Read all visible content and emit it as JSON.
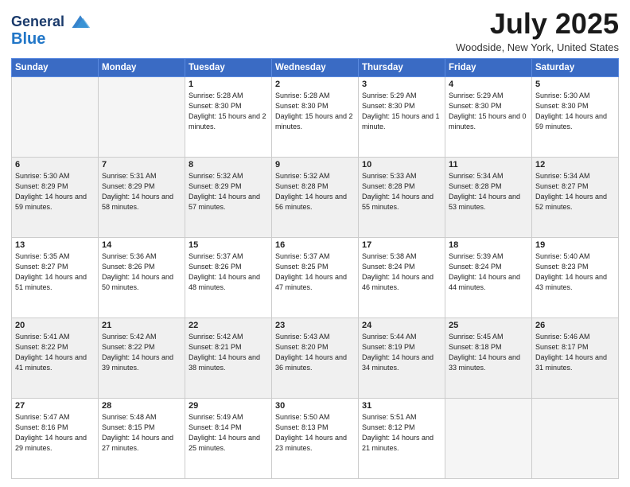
{
  "header": {
    "logo_line1": "General",
    "logo_line2": "Blue",
    "month_title": "July 2025",
    "location": "Woodside, New York, United States"
  },
  "weekdays": [
    "Sunday",
    "Monday",
    "Tuesday",
    "Wednesday",
    "Thursday",
    "Friday",
    "Saturday"
  ],
  "weeks": [
    [
      {
        "day": null
      },
      {
        "day": null
      },
      {
        "day": "1",
        "rise": "Sunrise: 5:28 AM",
        "set": "Sunset: 8:30 PM",
        "daylight": "Daylight: 15 hours and 2 minutes."
      },
      {
        "day": "2",
        "rise": "Sunrise: 5:28 AM",
        "set": "Sunset: 8:30 PM",
        "daylight": "Daylight: 15 hours and 2 minutes."
      },
      {
        "day": "3",
        "rise": "Sunrise: 5:29 AM",
        "set": "Sunset: 8:30 PM",
        "daylight": "Daylight: 15 hours and 1 minute."
      },
      {
        "day": "4",
        "rise": "Sunrise: 5:29 AM",
        "set": "Sunset: 8:30 PM",
        "daylight": "Daylight: 15 hours and 0 minutes."
      },
      {
        "day": "5",
        "rise": "Sunrise: 5:30 AM",
        "set": "Sunset: 8:30 PM",
        "daylight": "Daylight: 14 hours and 59 minutes."
      }
    ],
    [
      {
        "day": "6",
        "rise": "Sunrise: 5:30 AM",
        "set": "Sunset: 8:29 PM",
        "daylight": "Daylight: 14 hours and 59 minutes."
      },
      {
        "day": "7",
        "rise": "Sunrise: 5:31 AM",
        "set": "Sunset: 8:29 PM",
        "daylight": "Daylight: 14 hours and 58 minutes."
      },
      {
        "day": "8",
        "rise": "Sunrise: 5:32 AM",
        "set": "Sunset: 8:29 PM",
        "daylight": "Daylight: 14 hours and 57 minutes."
      },
      {
        "day": "9",
        "rise": "Sunrise: 5:32 AM",
        "set": "Sunset: 8:28 PM",
        "daylight": "Daylight: 14 hours and 56 minutes."
      },
      {
        "day": "10",
        "rise": "Sunrise: 5:33 AM",
        "set": "Sunset: 8:28 PM",
        "daylight": "Daylight: 14 hours and 55 minutes."
      },
      {
        "day": "11",
        "rise": "Sunrise: 5:34 AM",
        "set": "Sunset: 8:28 PM",
        "daylight": "Daylight: 14 hours and 53 minutes."
      },
      {
        "day": "12",
        "rise": "Sunrise: 5:34 AM",
        "set": "Sunset: 8:27 PM",
        "daylight": "Daylight: 14 hours and 52 minutes."
      }
    ],
    [
      {
        "day": "13",
        "rise": "Sunrise: 5:35 AM",
        "set": "Sunset: 8:27 PM",
        "daylight": "Daylight: 14 hours and 51 minutes."
      },
      {
        "day": "14",
        "rise": "Sunrise: 5:36 AM",
        "set": "Sunset: 8:26 PM",
        "daylight": "Daylight: 14 hours and 50 minutes."
      },
      {
        "day": "15",
        "rise": "Sunrise: 5:37 AM",
        "set": "Sunset: 8:26 PM",
        "daylight": "Daylight: 14 hours and 48 minutes."
      },
      {
        "day": "16",
        "rise": "Sunrise: 5:37 AM",
        "set": "Sunset: 8:25 PM",
        "daylight": "Daylight: 14 hours and 47 minutes."
      },
      {
        "day": "17",
        "rise": "Sunrise: 5:38 AM",
        "set": "Sunset: 8:24 PM",
        "daylight": "Daylight: 14 hours and 46 minutes."
      },
      {
        "day": "18",
        "rise": "Sunrise: 5:39 AM",
        "set": "Sunset: 8:24 PM",
        "daylight": "Daylight: 14 hours and 44 minutes."
      },
      {
        "day": "19",
        "rise": "Sunrise: 5:40 AM",
        "set": "Sunset: 8:23 PM",
        "daylight": "Daylight: 14 hours and 43 minutes."
      }
    ],
    [
      {
        "day": "20",
        "rise": "Sunrise: 5:41 AM",
        "set": "Sunset: 8:22 PM",
        "daylight": "Daylight: 14 hours and 41 minutes."
      },
      {
        "day": "21",
        "rise": "Sunrise: 5:42 AM",
        "set": "Sunset: 8:22 PM",
        "daylight": "Daylight: 14 hours and 39 minutes."
      },
      {
        "day": "22",
        "rise": "Sunrise: 5:42 AM",
        "set": "Sunset: 8:21 PM",
        "daylight": "Daylight: 14 hours and 38 minutes."
      },
      {
        "day": "23",
        "rise": "Sunrise: 5:43 AM",
        "set": "Sunset: 8:20 PM",
        "daylight": "Daylight: 14 hours and 36 minutes."
      },
      {
        "day": "24",
        "rise": "Sunrise: 5:44 AM",
        "set": "Sunset: 8:19 PM",
        "daylight": "Daylight: 14 hours and 34 minutes."
      },
      {
        "day": "25",
        "rise": "Sunrise: 5:45 AM",
        "set": "Sunset: 8:18 PM",
        "daylight": "Daylight: 14 hours and 33 minutes."
      },
      {
        "day": "26",
        "rise": "Sunrise: 5:46 AM",
        "set": "Sunset: 8:17 PM",
        "daylight": "Daylight: 14 hours and 31 minutes."
      }
    ],
    [
      {
        "day": "27",
        "rise": "Sunrise: 5:47 AM",
        "set": "Sunset: 8:16 PM",
        "daylight": "Daylight: 14 hours and 29 minutes."
      },
      {
        "day": "28",
        "rise": "Sunrise: 5:48 AM",
        "set": "Sunset: 8:15 PM",
        "daylight": "Daylight: 14 hours and 27 minutes."
      },
      {
        "day": "29",
        "rise": "Sunrise: 5:49 AM",
        "set": "Sunset: 8:14 PM",
        "daylight": "Daylight: 14 hours and 25 minutes."
      },
      {
        "day": "30",
        "rise": "Sunrise: 5:50 AM",
        "set": "Sunset: 8:13 PM",
        "daylight": "Daylight: 14 hours and 23 minutes."
      },
      {
        "day": "31",
        "rise": "Sunrise: 5:51 AM",
        "set": "Sunset: 8:12 PM",
        "daylight": "Daylight: 14 hours and 21 minutes."
      },
      {
        "day": null
      },
      {
        "day": null
      }
    ]
  ]
}
